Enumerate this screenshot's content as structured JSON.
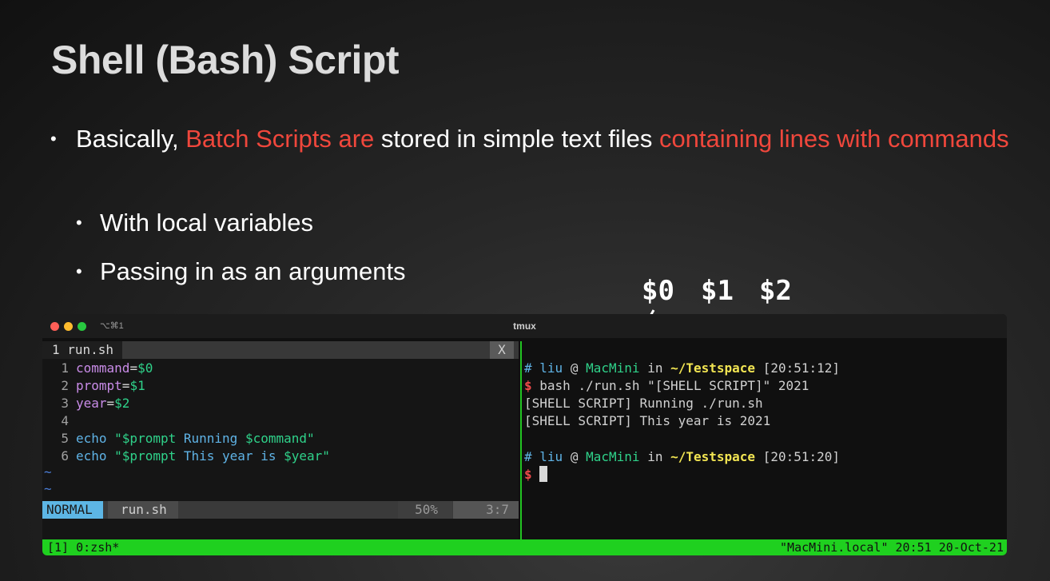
{
  "slide": {
    "title": "Shell (Bash) Script",
    "bullet_dot": "•",
    "bullet1": {
      "p1": "Basically, ",
      "p2": "Batch Scripts are",
      "p3": " stored in simple text files ",
      "p4": "containing lines with commands"
    },
    "bullet2": "With local variables",
    "bullet3": "Passing in as an arguments",
    "args": [
      "$0",
      "$1",
      "$2"
    ]
  },
  "window": {
    "shortcut": "⌥⌘1",
    "title": "tmux"
  },
  "vim": {
    "tab_name": "1 run.sh",
    "tab_close": "X",
    "lines": [
      {
        "num": "1",
        "name": "command",
        "eq": "=",
        "val": "$0"
      },
      {
        "num": "2",
        "name": "prompt",
        "eq": "=",
        "val": "$1"
      },
      {
        "num": "3",
        "name": "year",
        "eq": "=",
        "val": "$2"
      },
      {
        "num": "4"
      },
      {
        "num": "5",
        "cmd": "echo",
        "q1": " \"",
        "v1": "$prompt",
        "t1": " Running ",
        "v2": "$command",
        "q2": "\""
      },
      {
        "num": "6",
        "cmd": "echo",
        "q1": " \"",
        "v1": "$prompt",
        "t1": " This year is ",
        "v2": "$year",
        "q2": "\""
      }
    ],
    "tilde": "~",
    "status": {
      "mode": "NORMAL",
      "file": "run.sh",
      "percent": "50%",
      "position": "3:7"
    }
  },
  "terminal": {
    "prompt1": {
      "hash": "#",
      "user": "liu",
      "at": "@",
      "host": "MacMini",
      "in": "in",
      "dir": "~/Testspace",
      "time": "[20:51:12]"
    },
    "dollar": "$",
    "command": "bash ./run.sh \"[SHELL SCRIPT]\" 2021",
    "output1": "[SHELL SCRIPT] Running ./run.sh",
    "output2": "[SHELL SCRIPT] This year is 2021",
    "prompt2": {
      "hash": "#",
      "user": "liu",
      "at": "@",
      "host": "MacMini",
      "in": "in",
      "dir": "~/Testspace",
      "time": "[20:51:20]"
    }
  },
  "tmux": {
    "left": "[1] 0:zsh*",
    "right": "\"MacMini.local\" 20:51 20-Oct-21"
  },
  "colors": {
    "accent_red": "#f0473c",
    "tmux_green": "#1fd01f",
    "vim_mode_blue": "#5db6e5"
  }
}
